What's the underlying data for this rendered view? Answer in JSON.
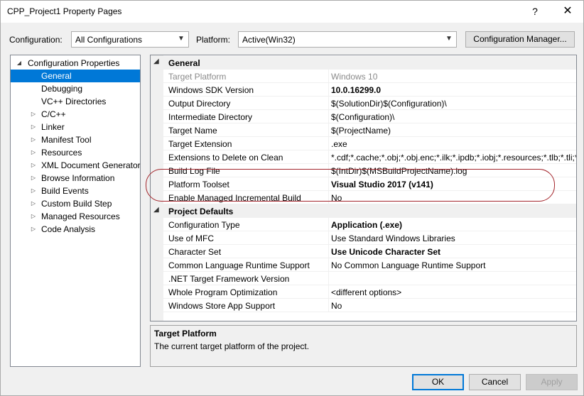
{
  "window": {
    "title": "CPP_Project1 Property Pages",
    "help_glyph": "?",
    "close_glyph": "✕"
  },
  "toolbar": {
    "configuration_label": "Configuration:",
    "configuration_value": "All Configurations",
    "platform_label": "Platform:",
    "platform_value": "Active(Win32)",
    "config_manager_label": "Configuration Manager..."
  },
  "tree": {
    "root": "Configuration Properties",
    "items": [
      {
        "label": "General",
        "expandable": false,
        "selected": true
      },
      {
        "label": "Debugging",
        "expandable": false
      },
      {
        "label": "VC++ Directories",
        "expandable": false
      },
      {
        "label": "C/C++",
        "expandable": true
      },
      {
        "label": "Linker",
        "expandable": true
      },
      {
        "label": "Manifest Tool",
        "expandable": true
      },
      {
        "label": "Resources",
        "expandable": true
      },
      {
        "label": "XML Document Generator",
        "expandable": true
      },
      {
        "label": "Browse Information",
        "expandable": true
      },
      {
        "label": "Build Events",
        "expandable": true
      },
      {
        "label": "Custom Build Step",
        "expandable": true
      },
      {
        "label": "Managed Resources",
        "expandable": true
      },
      {
        "label": "Code Analysis",
        "expandable": true
      }
    ]
  },
  "grid": {
    "categories": [
      {
        "name": "General",
        "props": [
          {
            "name": "Target Platform",
            "value": "Windows 10",
            "readonly": true
          },
          {
            "name": "Windows SDK Version",
            "value": "10.0.16299.0",
            "bold": true
          },
          {
            "name": "Output Directory",
            "value": "$(SolutionDir)$(Configuration)\\"
          },
          {
            "name": "Intermediate Directory",
            "value": "$(Configuration)\\"
          },
          {
            "name": "Target Name",
            "value": "$(ProjectName)"
          },
          {
            "name": "Target Extension",
            "value": ".exe"
          },
          {
            "name": "Extensions to Delete on Clean",
            "value": "*.cdf;*.cache;*.obj;*.obj.enc;*.ilk;*.ipdb;*.iobj;*.resources;*.tlb;*.tli;*"
          },
          {
            "name": "Build Log File",
            "value": "$(IntDir)$(MSBuildProjectName).log"
          },
          {
            "name": "Platform Toolset",
            "value": "Visual Studio 2017 (v141)",
            "bold": true
          },
          {
            "name": "Enable Managed Incremental Build",
            "value": "No"
          }
        ]
      },
      {
        "name": "Project Defaults",
        "props": [
          {
            "name": "Configuration Type",
            "value": "Application (.exe)",
            "bold": true
          },
          {
            "name": "Use of MFC",
            "value": "Use Standard Windows Libraries"
          },
          {
            "name": "Character Set",
            "value": "Use Unicode Character Set",
            "bold": true
          },
          {
            "name": "Common Language Runtime Support",
            "value": "No Common Language Runtime Support"
          },
          {
            "name": ".NET Target Framework Version",
            "value": ""
          },
          {
            "name": "Whole Program Optimization",
            "value": "<different options>"
          },
          {
            "name": "Windows Store App Support",
            "value": "No"
          }
        ]
      }
    ]
  },
  "description": {
    "title": "Target Platform",
    "text": "The current target platform of the project."
  },
  "buttons": {
    "ok": "OK",
    "cancel": "Cancel",
    "apply": "Apply"
  },
  "colors": {
    "selection": "#0078d7",
    "annotation": "#a4262c"
  }
}
